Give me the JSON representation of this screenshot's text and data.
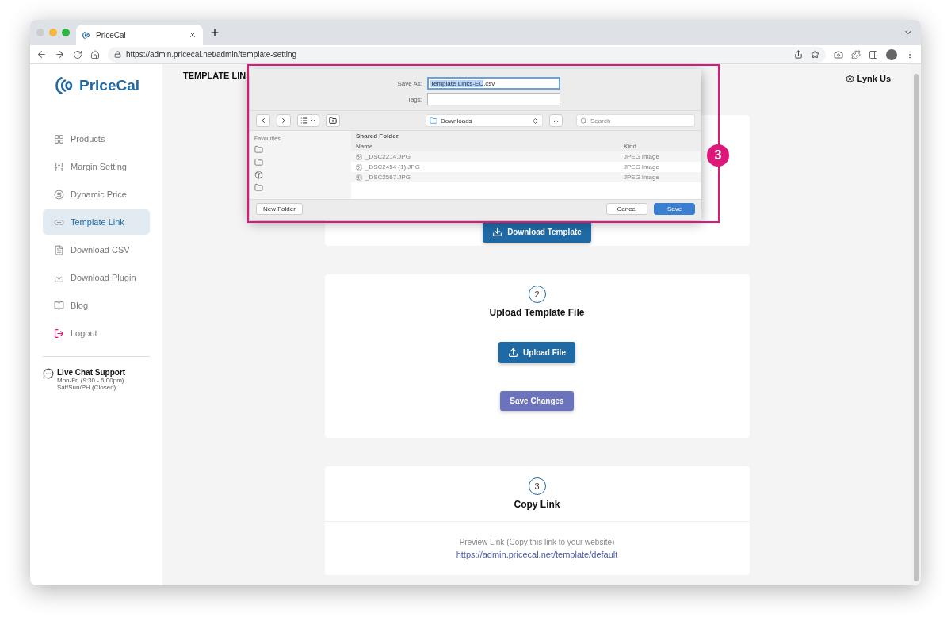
{
  "browser": {
    "tab_title": "PriceCal",
    "url": "https://admin.pricecal.net/admin/template-setting"
  },
  "sidebar": {
    "logo": "PriceCal",
    "items": [
      {
        "label": "Products",
        "selected": false
      },
      {
        "label": "Margin Setting",
        "selected": false
      },
      {
        "label": "Dynamic Price",
        "selected": false
      },
      {
        "label": "Template Link",
        "selected": true
      },
      {
        "label": "Download CSV",
        "selected": false
      },
      {
        "label": "Download Plugin",
        "selected": false
      },
      {
        "label": "Blog",
        "selected": false
      },
      {
        "label": "Logout",
        "selected": false
      }
    ],
    "support": {
      "title": "Live Chat Support",
      "hours": [
        "Mon-Fri (9:30 - 6:00pm)",
        "Sat/Sun/PH (Closed)"
      ]
    }
  },
  "header": {
    "title": "TEMPLATE LIN",
    "action": "Lynk Us"
  },
  "cards": [
    {
      "kind": "download",
      "button": "Download Template"
    },
    {
      "kind": "upload",
      "step": "2",
      "title": "Upload Template File",
      "button": "Upload File",
      "save": "Save Changes"
    },
    {
      "kind": "link",
      "step": "3",
      "title": "Copy Link",
      "caption": "Preview Link (Copy this link to your website)",
      "link": "https://admin.pricecal.net/template/default"
    }
  ],
  "save_dialog": {
    "save_as_label": "Save As:",
    "filename_selected": "Template Links-EC",
    "filename_rest": ".csv",
    "tags_label": "Tags:",
    "location": "Downloads",
    "search": {
      "placeholder": "Search"
    },
    "sidebar_title": "Favourites",
    "folder_title": "Shared Folder",
    "columns": [
      "Name",
      "Kind"
    ],
    "files": [
      {
        "name": "_DSC2214.JPG",
        "kind": "JPEG image",
        "disabled": true
      },
      {
        "name": "_DSC2454 (1).JPG",
        "kind": "JPEG image",
        "disabled": true
      },
      {
        "name": "_DSC2567.JPG",
        "kind": "JPEG image",
        "disabled": true
      }
    ],
    "buttons": {
      "new_folder": "New Folder",
      "cancel": "Cancel",
      "save": "Save"
    }
  },
  "annotation": {
    "number": "3"
  }
}
